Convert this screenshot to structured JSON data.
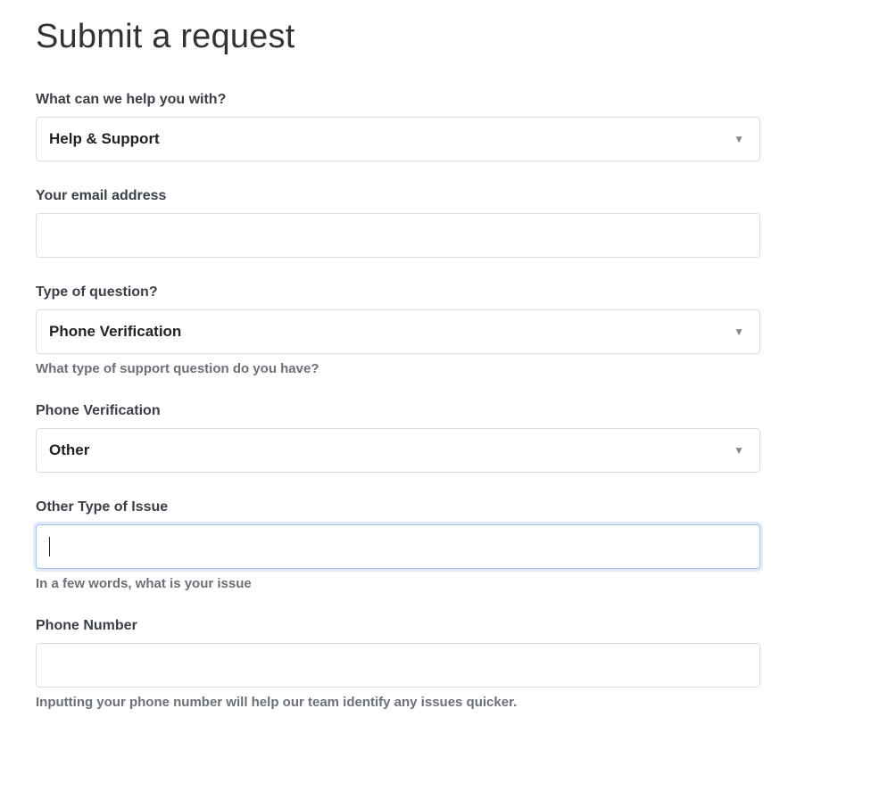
{
  "page": {
    "title": "Submit a request"
  },
  "form": {
    "help_with": {
      "label": "What can we help you with?",
      "selected": "Help & Support"
    },
    "email": {
      "label": "Your email address",
      "value": ""
    },
    "question_type": {
      "label": "Type of question?",
      "selected": "Phone Verification",
      "help": "What type of support question do you have?"
    },
    "phone_verification": {
      "label": "Phone Verification",
      "selected": "Other"
    },
    "other_issue": {
      "label": "Other Type of Issue",
      "value": "",
      "help": "In a few words, what is your issue"
    },
    "phone_number": {
      "label": "Phone Number",
      "value": "",
      "help": "Inputting your phone number will help our team identify any issues quicker."
    }
  }
}
